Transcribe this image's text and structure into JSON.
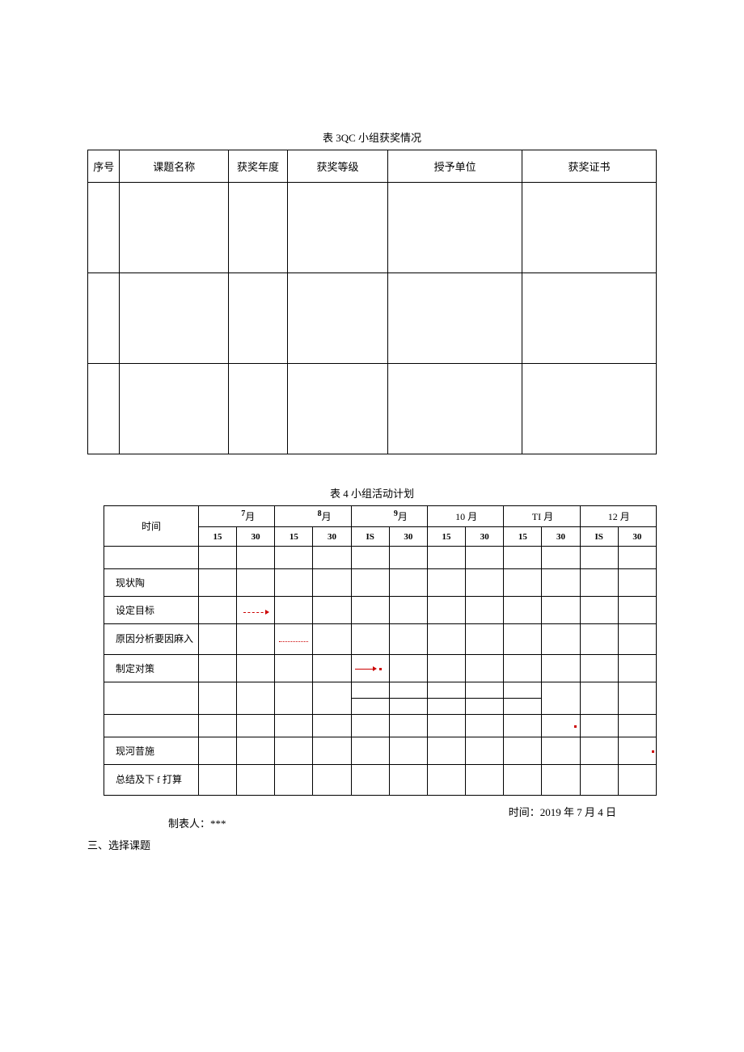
{
  "table1": {
    "title": "表 3QC 小组获奖情况",
    "headers": {
      "seq": "序号",
      "name": "课题名称",
      "year": "获奖年度",
      "level": "获奖等级",
      "unit": "授予单位",
      "cert": "获奖证书"
    }
  },
  "table2": {
    "title": "表 4 小组活动计划",
    "time_label": "时间",
    "months": {
      "m7": "月",
      "m7_sup": "7",
      "m8": "月",
      "m8_sup": "8",
      "m9": "月",
      "m9_sup": "9",
      "m10": "10 月",
      "m11": "TI 月",
      "m12": "12 月"
    },
    "days": {
      "d15": "15",
      "d30": "30",
      "dIS": "IS"
    },
    "rows": {
      "r1": "",
      "r2": "现状陶",
      "r3": "设定目标",
      "r4": "原因分析要因麻入",
      "r5": "制定对策",
      "r6": "",
      "r7": "",
      "r8": "现河昔施",
      "r9": "总结及下 f 打算"
    }
  },
  "footer": {
    "maker": "制表人：***",
    "time": "时间：2019 年 7 月 4 日"
  },
  "section": "三、选择课题"
}
